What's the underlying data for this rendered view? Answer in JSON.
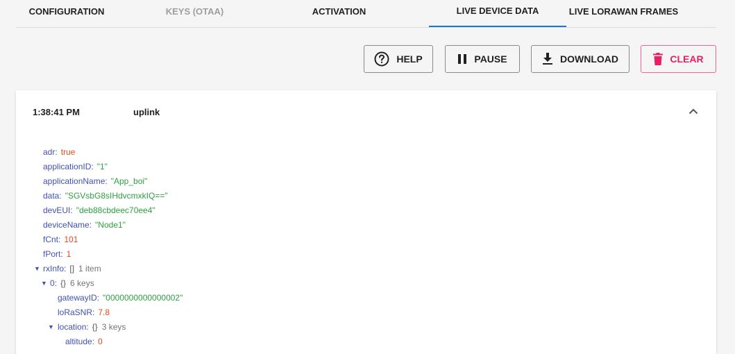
{
  "tabs": [
    {
      "label": "CONFIGURATION"
    },
    {
      "label": "KEYS (OTAA)"
    },
    {
      "label": "ACTIVATION"
    },
    {
      "label": "LIVE DEVICE DATA"
    },
    {
      "label": "LIVE LORAWAN FRAMES"
    }
  ],
  "toolbar": {
    "help_label": "HELP",
    "pause_label": "PAUSE",
    "download_label": "DOWNLOAD",
    "clear_label": "CLEAR"
  },
  "colors": {
    "accent": "#1976d2",
    "danger": "#e91e63",
    "string": "#2ea043",
    "number": "#e64a19",
    "key": "#3f51b5"
  },
  "event": {
    "time": "1:38:41 PM",
    "type": "uplink",
    "fields": {
      "adr": {
        "key": "adr",
        "value": "true"
      },
      "applicationID": {
        "key": "applicationID",
        "value": "\"1\""
      },
      "applicationName": {
        "key": "applicationName",
        "value": "\"App_boi\""
      },
      "data": {
        "key": "data",
        "value": "\"SGVsbG8sIHdvcmxkIQ==\""
      },
      "devEUI": {
        "key": "devEUI",
        "value": "\"deb88cbdeec70ee4\""
      },
      "deviceName": {
        "key": "deviceName",
        "value": "\"Node1\""
      },
      "fCnt": {
        "key": "fCnt",
        "value": "101"
      },
      "fPort": {
        "key": "fPort",
        "value": "1"
      },
      "rxInfo": {
        "key": "rxInfo",
        "brace": "[]",
        "meta": "1 item"
      },
      "rx0": {
        "key": "0",
        "brace": "{}",
        "meta": "6 keys"
      },
      "gatewayID": {
        "key": "gatewayID",
        "value": "\"0000000000000002\""
      },
      "loRaSNR": {
        "key": "loRaSNR",
        "value": "7.8"
      },
      "location": {
        "key": "location",
        "brace": "{}",
        "meta": "3 keys"
      },
      "altitude": {
        "key": "altitude",
        "value": "0"
      }
    }
  }
}
